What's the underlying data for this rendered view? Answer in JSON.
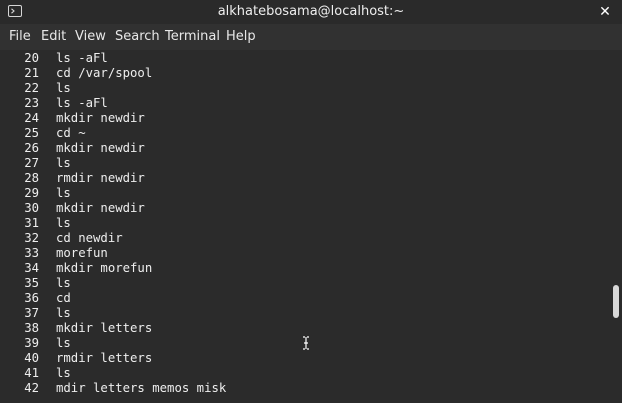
{
  "window": {
    "title": "alkhatebosama@localhost:~",
    "close_glyph": "✕",
    "icon": "terminal-icon"
  },
  "menu": {
    "items": [
      {
        "label": "File"
      },
      {
        "label": "Edit"
      },
      {
        "label": "View"
      },
      {
        "label": "Search"
      },
      {
        "label": "Terminal"
      },
      {
        "label": "Help"
      }
    ]
  },
  "terminal": {
    "lines": [
      {
        "num": "20",
        "cmd": "ls -aFl"
      },
      {
        "num": "21",
        "cmd": "cd /var/spool"
      },
      {
        "num": "22",
        "cmd": "ls"
      },
      {
        "num": "23",
        "cmd": "ls -aFl"
      },
      {
        "num": "24",
        "cmd": "mkdir newdir"
      },
      {
        "num": "25",
        "cmd": "cd ~"
      },
      {
        "num": "26",
        "cmd": "mkdir newdir"
      },
      {
        "num": "27",
        "cmd": "ls"
      },
      {
        "num": "28",
        "cmd": "rmdir newdir"
      },
      {
        "num": "29",
        "cmd": "ls"
      },
      {
        "num": "30",
        "cmd": "mkdir newdir"
      },
      {
        "num": "31",
        "cmd": "ls"
      },
      {
        "num": "32",
        "cmd": "cd newdir"
      },
      {
        "num": "33",
        "cmd": "morefun"
      },
      {
        "num": "34",
        "cmd": "mkdir morefun"
      },
      {
        "num": "35",
        "cmd": "ls"
      },
      {
        "num": "36",
        "cmd": "cd"
      },
      {
        "num": "37",
        "cmd": "ls"
      },
      {
        "num": "38",
        "cmd": "mkdir letters"
      },
      {
        "num": "39",
        "cmd": "ls"
      },
      {
        "num": "40",
        "cmd": "rmdir letters"
      },
      {
        "num": "41",
        "cmd": "ls"
      },
      {
        "num": "42",
        "cmd": "mdir letters memos misk"
      }
    ]
  },
  "colors": {
    "background": "#2b2b2b",
    "text": "#eeeeee",
    "titlebar": "#2a2a2a"
  }
}
